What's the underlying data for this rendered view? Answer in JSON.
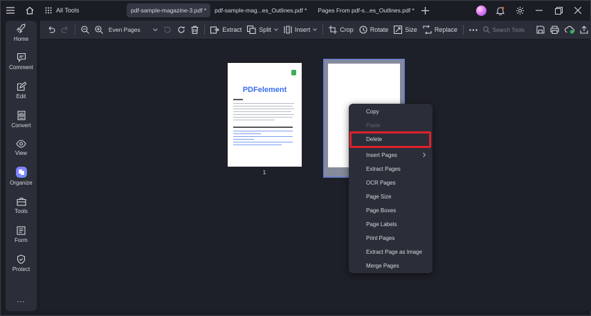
{
  "titlebar": {
    "all_tools": "All Tools",
    "tabs": [
      {
        "label": "pdf-sample-magazine-3.pdf *",
        "active": true
      },
      {
        "label": "pdf-sample-mag...es_Outlines.pdf *",
        "active": false
      },
      {
        "label": "Pages  From  pdf-s...es_Outlines.pdf *",
        "active": false
      }
    ]
  },
  "toolbar": {
    "page_select": "Even Pages",
    "extract": "Extract",
    "split": "Split",
    "insert": "Insert",
    "crop": "Crop",
    "rotate": "Rotate",
    "size": "Size",
    "replace": "Replace",
    "search_placeholder": "Search Tools"
  },
  "sidebar": {
    "items": [
      {
        "label": "Home",
        "icon": "rocket-icon"
      },
      {
        "label": "Comment",
        "icon": "comment-icon"
      },
      {
        "label": "Edit",
        "icon": "edit-icon"
      },
      {
        "label": "Convert",
        "icon": "convert-icon"
      },
      {
        "label": "View",
        "icon": "eye-icon"
      },
      {
        "label": "Organize",
        "icon": "organize-icon"
      },
      {
        "label": "Tools",
        "icon": "toolbox-icon"
      },
      {
        "label": "Form",
        "icon": "form-icon"
      },
      {
        "label": "Protect",
        "icon": "shield-icon"
      }
    ],
    "more": "..."
  },
  "canvas": {
    "page1": {
      "logo": "PDFelement",
      "number": "1"
    }
  },
  "context_menu": {
    "items": [
      {
        "label": "Copy",
        "disabled": false
      },
      {
        "label": "Paste",
        "disabled": true
      },
      {
        "label": "Delete",
        "disabled": false,
        "highlighted": true
      },
      {
        "label": "Insert Pages",
        "disabled": false,
        "submenu": true
      },
      {
        "label": "Extract Pages",
        "disabled": false
      },
      {
        "label": "OCR Pages",
        "disabled": false
      },
      {
        "label": "Page Size",
        "disabled": false
      },
      {
        "label": "Page Boxes",
        "disabled": false
      },
      {
        "label": "Page Labels",
        "disabled": false
      },
      {
        "label": "Print Pages",
        "disabled": false
      },
      {
        "label": "Extract Page as Image",
        "disabled": false
      },
      {
        "label": "Merge Pages",
        "disabled": false
      }
    ]
  },
  "colors": {
    "background": "#1b1d25",
    "panel": "#2b2e38",
    "accent": "#3a6df0",
    "highlight_border": "#e0202a"
  }
}
